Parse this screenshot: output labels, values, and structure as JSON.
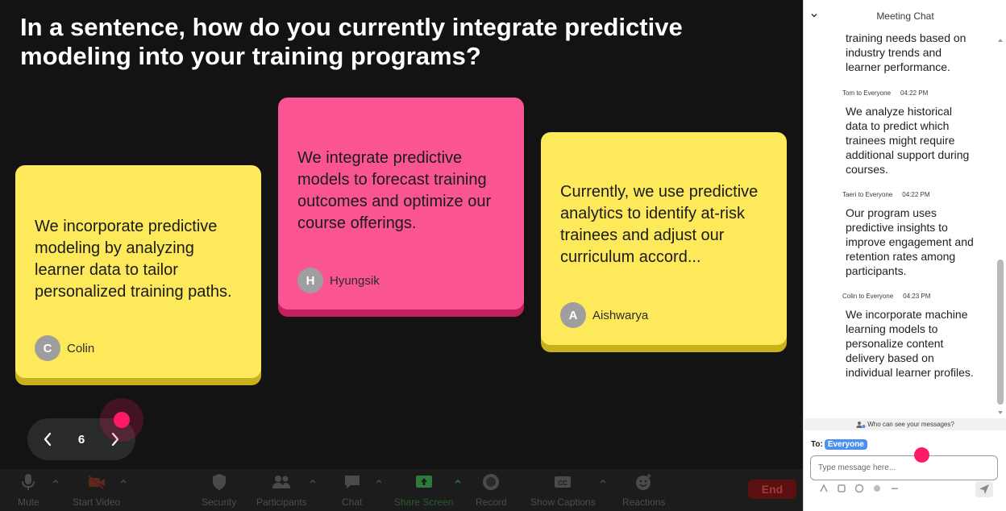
{
  "slide": {
    "question": "In a sentence, how do you currently integrate predictive modeling into your training programs?",
    "page_number": "6",
    "cards": [
      {
        "color": "#fde95a",
        "text": "We incorporate predictive modeling by analyzing learner data to tailor personalized training paths.",
        "avatar_initial": "C",
        "author": "Colin"
      },
      {
        "color": "#fa5592",
        "text": "We integrate predictive models to forecast training outcomes and optimize our course offerings.",
        "avatar_initial": "H",
        "author": "Hyungsik"
      },
      {
        "color": "#fde95a",
        "text": "Currently, we use predictive analytics to identify at-risk trainees and adjust our curriculum accord...",
        "avatar_initial": "A",
        "author": "Aishwarya"
      }
    ]
  },
  "toolbar": {
    "items": [
      {
        "label": "Mute",
        "icon": "microphone-icon"
      },
      {
        "label": "Start Video",
        "icon": "video-off-icon"
      },
      {
        "label": "Security",
        "icon": "shield-icon"
      },
      {
        "label": "Participants",
        "icon": "participants-icon"
      },
      {
        "label": "Chat",
        "icon": "chat-bubble-icon"
      },
      {
        "label": "Share Screen",
        "icon": "share-screen-icon"
      },
      {
        "label": "Record",
        "icon": "record-icon"
      },
      {
        "label": "Show Captions",
        "icon": "captions-icon"
      },
      {
        "label": "Reactions",
        "icon": "emoji-add-icon"
      }
    ],
    "end_label": "End"
  },
  "chat": {
    "title": "Meeting Chat",
    "messages": [
      {
        "sender": "",
        "time": "",
        "text": "training needs based on industry trends and learner performance."
      },
      {
        "sender": "Tom to Everyone",
        "time": "04:22 PM",
        "text": "We analyze historical data to predict which trainees might require additional support during courses."
      },
      {
        "sender": "Taeri to Everyone",
        "time": "04:22 PM",
        "text": "Our program uses predictive insights to improve engagement and retention rates among participants."
      },
      {
        "sender": "Colin to Everyone",
        "time": "04:23 PM",
        "text": "We incorporate machine learning models to personalize content delivery based on individual learner profiles."
      }
    ],
    "visibility_text": "Who can see your messages?",
    "to_label": "To:",
    "recipient": "Everyone",
    "input_placeholder": "Type message here..."
  },
  "colors": {
    "accent_pink": "#ff1a66",
    "recipient_chip": "#4b8ff0",
    "share_screen_green": "#2f7a3a"
  }
}
